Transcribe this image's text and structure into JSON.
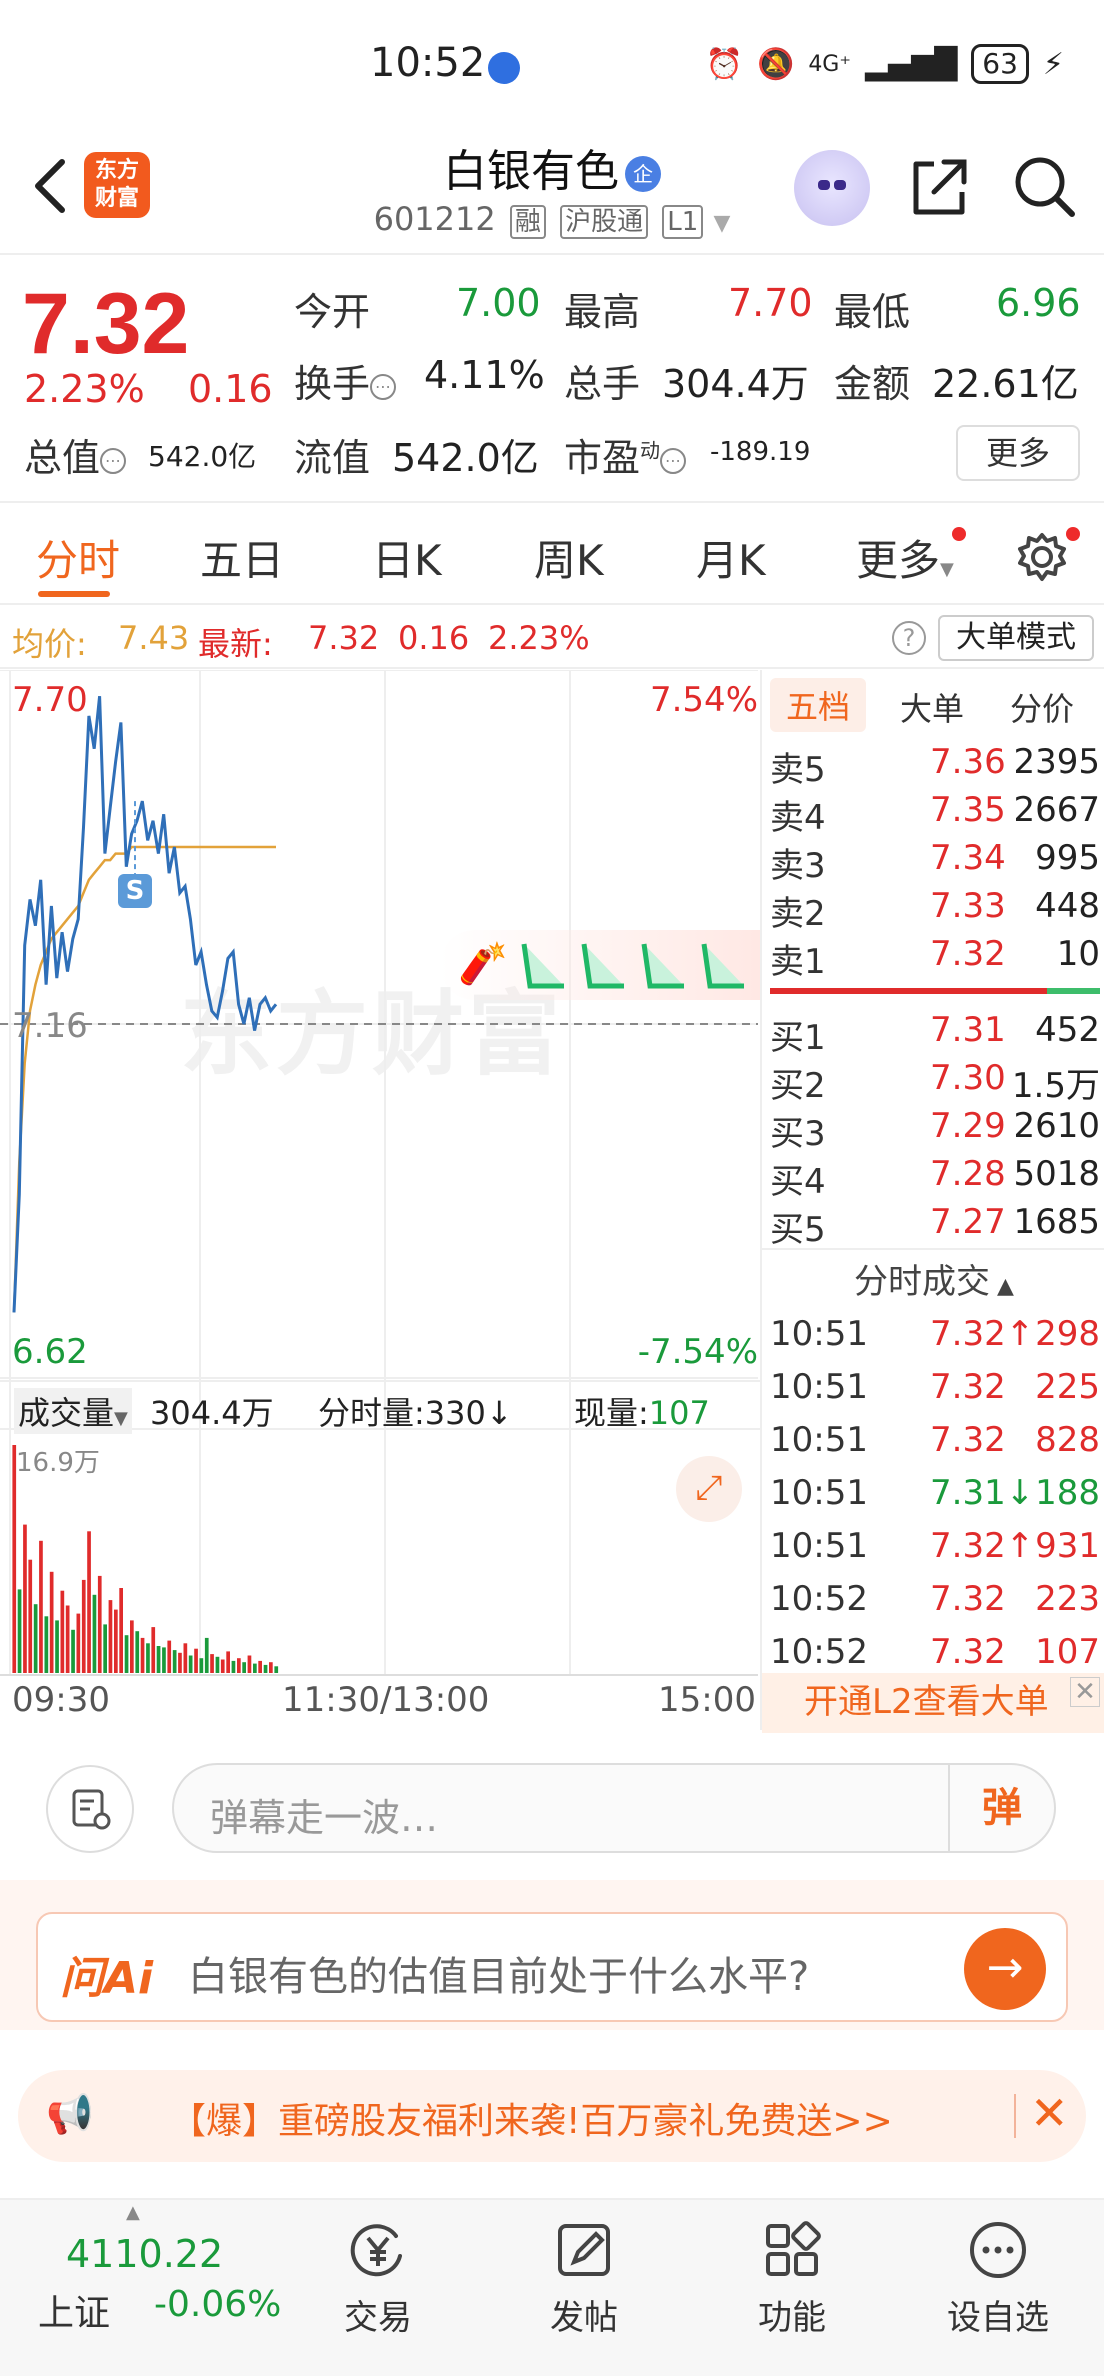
{
  "status": {
    "time": "10:52",
    "network": "4G⁺",
    "battery": "63"
  },
  "header": {
    "title": "白银有色",
    "title_badge": "企",
    "code": "601212",
    "tags": [
      "融",
      "沪股通",
      "L1"
    ],
    "logo_text": [
      "东方",
      "财富"
    ]
  },
  "quote": {
    "price": "7.32",
    "pct": "2.23%",
    "change": "0.16",
    "open_label": "今开",
    "open": "7.00",
    "high_label": "最高",
    "high": "7.70",
    "low_label": "最低",
    "low": "6.96",
    "turnover_label": "换手",
    "turnover": "4.11%",
    "volume_label": "总手",
    "volume": "304.4万",
    "amount_label": "金额",
    "amount": "22.61亿",
    "mktcap_label": "总值",
    "mktcap": "542.0亿",
    "float_label": "流值",
    "float": "542.0亿",
    "pe_label": "市盈",
    "pe_sup": "动",
    "pe": "-189.19",
    "more": "更多"
  },
  "tabs": [
    "分时",
    "五日",
    "日K",
    "周K",
    "月K",
    "更多"
  ],
  "avgbar": {
    "avg_label": "均价:",
    "avg": "7.43",
    "latest_label": "最新:",
    "latest": "7.32",
    "latest_chg": "0.16",
    "latest_pct": "2.23%",
    "mode_button": "大单模式"
  },
  "chart_labels": {
    "top_price": "7.70",
    "top_pct": "7.54%",
    "mid_price": "7.16",
    "bot_price": "6.62",
    "bot_pct": "-7.54%",
    "marker": "S",
    "watermark": "东方财富",
    "volume_label": "成交量",
    "volume_total": "304.4万",
    "minute_vol_label": "分时量:",
    "minute_vol": "330",
    "current_vol_label": "现量:",
    "current_vol": "107",
    "vol_max": "16.9万",
    "time_start": "09:30",
    "time_mid": "11:30/13:00",
    "time_end": "15:00"
  },
  "chart_data": {
    "type": "line",
    "ylim": [
      6.62,
      7.7
    ],
    "reference": 7.16,
    "price": [
      6.72,
      6.9,
      7.28,
      7.35,
      7.31,
      7.38,
      7.22,
      7.34,
      7.23,
      7.3,
      7.24,
      7.29,
      7.32,
      7.46,
      7.63,
      7.58,
      7.66,
      7.42,
      7.49,
      7.56,
      7.62,
      7.4,
      7.45,
      7.47,
      7.5,
      7.44,
      7.47,
      7.42,
      7.48,
      7.39,
      7.43,
      7.36,
      7.37,
      7.32,
      7.25,
      7.27,
      7.22,
      7.18,
      7.17,
      7.21,
      7.26,
      7.27,
      7.19,
      7.16,
      7.2,
      7.15,
      7.19,
      7.2,
      7.18,
      7.19
    ],
    "avg": [
      6.72,
      6.95,
      7.1,
      7.18,
      7.22,
      7.25,
      7.27,
      7.29,
      7.3,
      7.31,
      7.32,
      7.33,
      7.34,
      7.36,
      7.38,
      7.39,
      7.4,
      7.41,
      7.41,
      7.42,
      7.42,
      7.42,
      7.43,
      7.43,
      7.43,
      7.43,
      7.43,
      7.43,
      7.43,
      7.43,
      7.43,
      7.43,
      7.43,
      7.43,
      7.43,
      7.43,
      7.43,
      7.43,
      7.43,
      7.43,
      7.43,
      7.43,
      7.43,
      7.43,
      7.43,
      7.43,
      7.43,
      7.43,
      7.43,
      7.43
    ],
    "volume_ylim": [
      0,
      16.9
    ],
    "volume": [
      16.9,
      6.2,
      11.0,
      8.4,
      5.1,
      9.8,
      4.2,
      7.5,
      3.9,
      6.1,
      5.0,
      3.2,
      4.4,
      6.9,
      10.5,
      5.8,
      7.2,
      3.6,
      5.4,
      4.7,
      6.3,
      2.8,
      3.9,
      3.1,
      2.6,
      2.2,
      3.4,
      2.0,
      1.9,
      2.4,
      1.7,
      1.5,
      2.2,
      1.3,
      1.8,
      1.1,
      2.6,
      1.4,
      1.2,
      1.0,
      1.6,
      0.9,
      1.1,
      0.8,
      1.3,
      0.7,
      0.9,
      0.6,
      0.8,
      0.5
    ],
    "volume_up": [
      true,
      false,
      true,
      true,
      false,
      true,
      false,
      true,
      false,
      true,
      true,
      false,
      true,
      true,
      true,
      false,
      true,
      false,
      true,
      true,
      true,
      false,
      true,
      false,
      true,
      false,
      true,
      false,
      false,
      true,
      false,
      true,
      true,
      false,
      true,
      false,
      false,
      true,
      false,
      true,
      true,
      false,
      true,
      false,
      true,
      false,
      true,
      false,
      true,
      false
    ]
  },
  "order_book": {
    "tabs": [
      "五档",
      "大单",
      "分价"
    ],
    "sell": [
      {
        "label": "卖5",
        "price": "7.36",
        "vol": "2395"
      },
      {
        "label": "卖4",
        "price": "7.35",
        "vol": "2667"
      },
      {
        "label": "卖3",
        "price": "7.34",
        "vol": "995"
      },
      {
        "label": "卖2",
        "price": "7.33",
        "vol": "448"
      },
      {
        "label": "卖1",
        "price": "7.32",
        "vol": "10"
      }
    ],
    "buy": [
      {
        "label": "买1",
        "price": "7.31",
        "vol": "452"
      },
      {
        "label": "买2",
        "price": "7.30",
        "vol": "1.5万"
      },
      {
        "label": "买3",
        "price": "7.29",
        "vol": "2610"
      },
      {
        "label": "买4",
        "price": "7.28",
        "vol": "5018"
      },
      {
        "label": "买5",
        "price": "7.27",
        "vol": "1685"
      }
    ],
    "trades_title": "分时成交",
    "trades": [
      {
        "time": "10:51",
        "price": "7.32↑",
        "vol": "298",
        "color": "#e02b2b"
      },
      {
        "time": "10:51",
        "price": "7.32",
        "vol": "225",
        "color": "#e02b2b"
      },
      {
        "time": "10:51",
        "price": "7.32",
        "vol": "828",
        "color": "#e02b2b"
      },
      {
        "time": "10:51",
        "price": "7.31↓",
        "vol": "188",
        "color": "#1a9a3b"
      },
      {
        "time": "10:51",
        "price": "7.32↑",
        "vol": "931",
        "color": "#e02b2b"
      },
      {
        "time": "10:52",
        "price": "7.32",
        "vol": "223",
        "color": "#e02b2b"
      },
      {
        "time": "10:52",
        "price": "7.32",
        "vol": "107",
        "color": "#e02b2b"
      }
    ],
    "l2_banner": "开通L2查看大单"
  },
  "danmu": {
    "placeholder": "弹幕走一波…",
    "send": "弹"
  },
  "ai": {
    "logo": "问Ai",
    "question": "白银有色的估值目前处于什么水平?"
  },
  "promo": {
    "text": "【爆】重磅股友福利来袭!百万豪礼免费送>>"
  },
  "bottom_nav": {
    "index_value": "4110.22",
    "index_name": "上证",
    "index_change": "-0.06%",
    "items": [
      "交易",
      "发帖",
      "功能",
      "设自选"
    ]
  },
  "colors": {
    "up": "#e02b2b",
    "down": "#1a9a3b",
    "accent": "#f0661e",
    "price_line": "#2f6fb8",
    "avg_line": "#e2a23a"
  }
}
